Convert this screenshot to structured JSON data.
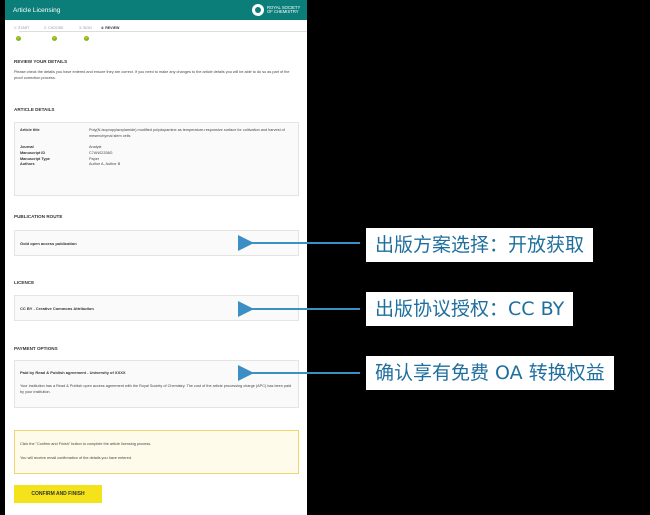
{
  "header": {
    "title": "Article Licensing",
    "brand": "ROYAL SOCIETY OF CHEMISTRY"
  },
  "steps": [
    {
      "label": "1: START",
      "done": true
    },
    {
      "label": "2: CHOOSE",
      "done": true
    },
    {
      "label": "3: SIGN",
      "done": true
    },
    {
      "label": "4: REVIEW",
      "done": false
    }
  ],
  "review": {
    "heading": "REVIEW YOUR DETAILS",
    "intro": "Please check the details you have entered and ensure they are correct. If you need to make any changes to the article details you will be able to do so as part of the proof correction process."
  },
  "article": {
    "heading": "ARTICLE DETAILS",
    "rows": [
      {
        "k": "Article title",
        "v": "Poly(N-isopropylacrylamide) modified polydopamine as temperature-responsive surface for cultivation and harvest of mesenchymal stem cells"
      },
      {
        "k": "Journal",
        "v": "Analyst"
      },
      {
        "k": "Manuscript ID",
        "v": "C7AN02336G"
      },
      {
        "k": "Manuscript Type",
        "v": "Paper"
      },
      {
        "k": "Authors",
        "v": "Author A, Author B"
      }
    ]
  },
  "publication": {
    "heading": "PUBLICATION ROUTE",
    "value": "Gold open access publication"
  },
  "licence": {
    "heading": "LICENCE",
    "value": "CC BY - Creative Commons Attribution"
  },
  "payment": {
    "heading": "PAYMENT OPTIONS",
    "value": "Paid by Read & Publish agreement - University of XXXX",
    "detail": "Your institution has a Read & Publish open access agreement with the Royal Society of Chemistry. The cost of the article processing charge (APC) has been paid by your institution."
  },
  "notice": {
    "line1": "Click the \"Confirm and Finish\" button to complete the article licensing process.",
    "line2": "You will receive email confirmation of the details you have entered."
  },
  "confirm_button": "CONFIRM AND FINISH",
  "annotations": {
    "route": "出版方案选择：开放获取",
    "licence": "出版协议授权：CC BY",
    "payment": "确认享有免费 OA 转换权益"
  },
  "colors": {
    "brand": "#0b7e79",
    "accent": "#f4e21a",
    "annotation_text": "#1f6f9e",
    "arrow": "#3b8fc4"
  }
}
